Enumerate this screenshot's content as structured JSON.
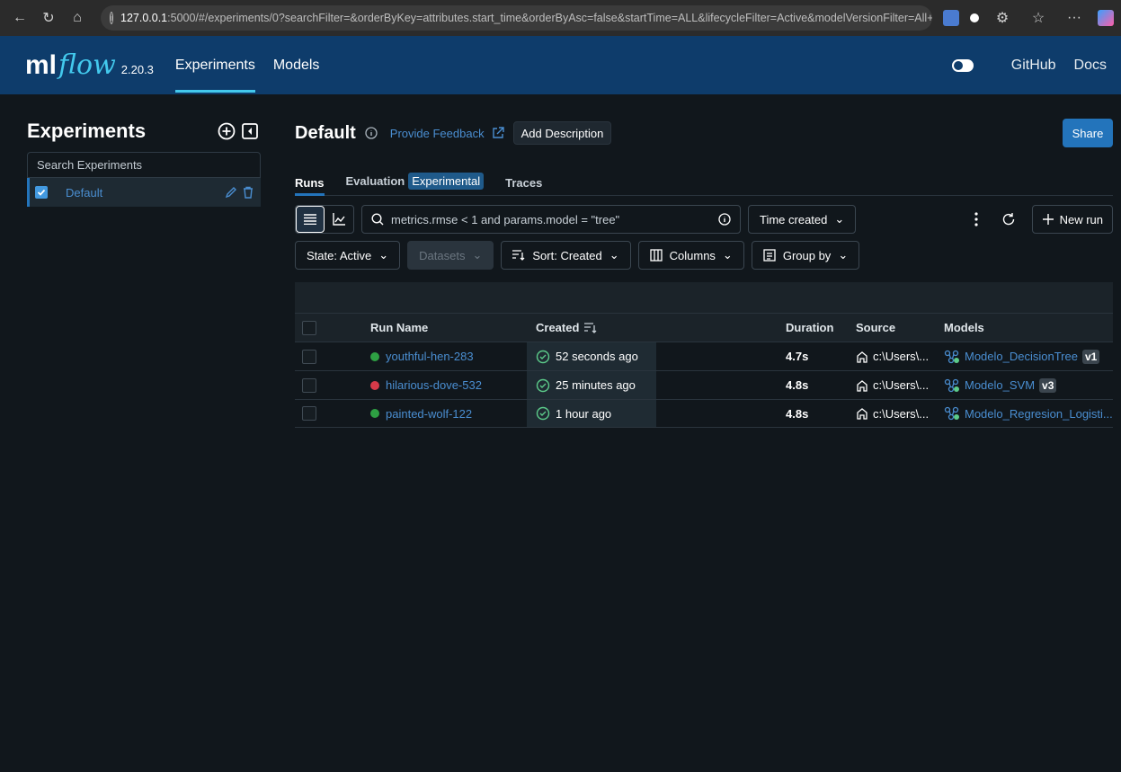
{
  "browser": {
    "url_host": "127.0.0.1",
    "url_rest": ":5000/#/experiments/0?searchFilter=&orderByKey=attributes.start_time&orderByAsc=false&startTime=ALL&lifecycleFilter=Active&modelVersionFilter=All+Ru..."
  },
  "header": {
    "logo_ml": "ml",
    "logo_flow": "flow",
    "version": "2.20.3",
    "nav": [
      "Experiments",
      "Models"
    ],
    "github": "GitHub",
    "docs": "Docs"
  },
  "sidebar": {
    "title": "Experiments",
    "search_placeholder": "Search Experiments",
    "experiments": [
      {
        "name": "Default"
      }
    ]
  },
  "experiment": {
    "title": "Default",
    "feedback": "Provide Feedback",
    "add_description": "Add Description",
    "share": "Share"
  },
  "tabs": {
    "runs": "Runs",
    "evaluation": "Evaluation",
    "experimental_badge": "Experimental",
    "traces": "Traces"
  },
  "controls": {
    "search_text": "metrics.rmse < 1 and params.model = \"tree\"",
    "time_created": "Time created",
    "new_run": "New run",
    "state": "State: Active",
    "datasets": "Datasets",
    "sort": "Sort: Created",
    "columns": "Columns",
    "group_by": "Group by"
  },
  "table": {
    "headers": {
      "run_name": "Run Name",
      "created": "Created",
      "duration": "Duration",
      "source": "Source",
      "models": "Models"
    },
    "rows": [
      {
        "name": "youthful-hen-283",
        "status_color": "#2ea043",
        "created": "52 seconds ago",
        "duration": "4.7s",
        "source": "c:\\Users\\...",
        "model": "Modelo_DecisionTree",
        "version": "v1"
      },
      {
        "name": "hilarious-dove-532",
        "status_color": "#d73a49",
        "created": "25 minutes ago",
        "duration": "4.8s",
        "source": "c:\\Users\\...",
        "model": "Modelo_SVM",
        "version": "v3"
      },
      {
        "name": "painted-wolf-122",
        "status_color": "#2ea043",
        "created": "1 hour ago",
        "duration": "4.8s",
        "source": "c:\\Users\\...",
        "model": "Modelo_Regresion_Logisti...",
        "version": ""
      }
    ]
  }
}
